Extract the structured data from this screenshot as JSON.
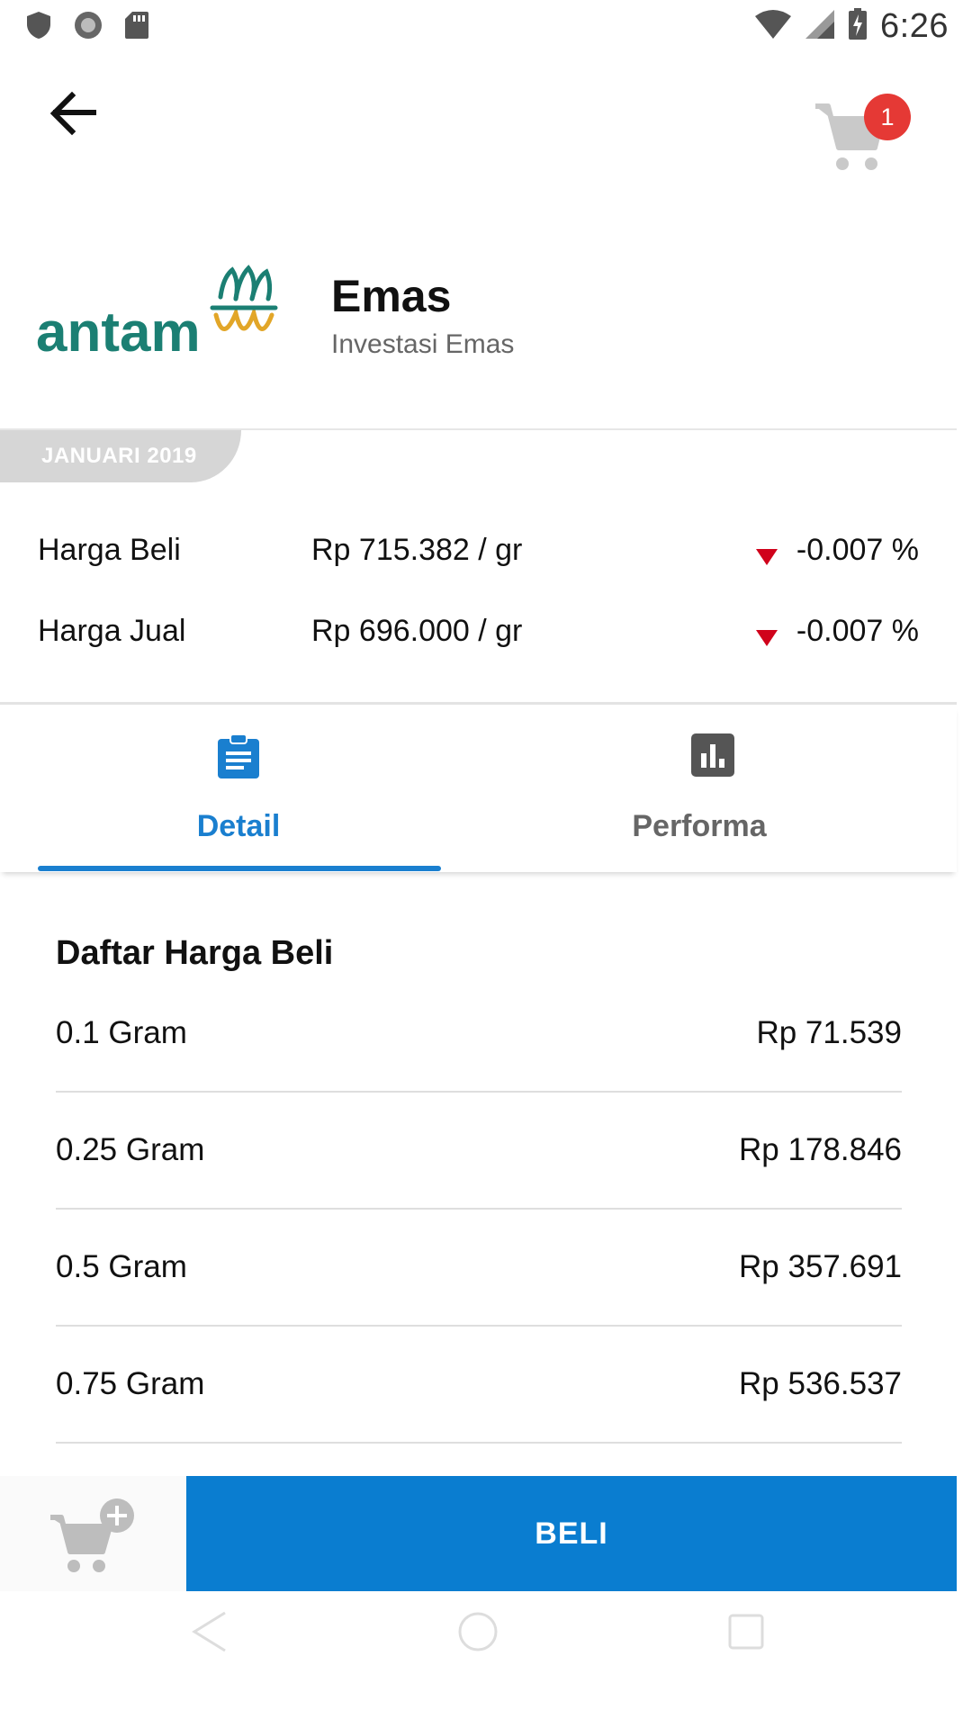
{
  "status_bar": {
    "time": "6:26"
  },
  "header": {
    "cart_count": "1"
  },
  "product": {
    "logo_text": "antam",
    "title": "Emas",
    "subtitle": "Investasi Emas"
  },
  "prices": {
    "period": "JANUARI 2019",
    "rows": [
      {
        "label": "Harga Beli",
        "value": "Rp 715.382 / gr",
        "change": "-0.007 %",
        "trend": "down"
      },
      {
        "label": "Harga Jual",
        "value": "Rp 696.000 / gr",
        "change": "-0.007 %",
        "trend": "down"
      }
    ]
  },
  "tabs": [
    {
      "label": "Detail",
      "active": true
    },
    {
      "label": "Performa",
      "active": false
    }
  ],
  "price_list": {
    "title": "Daftar Harga Beli",
    "items": [
      {
        "weight": "0.1 Gram",
        "price": "Rp 71.539"
      },
      {
        "weight": "0.25 Gram",
        "price": "Rp 178.846"
      },
      {
        "weight": "0.5 Gram",
        "price": "Rp 357.691"
      },
      {
        "weight": "0.75 Gram",
        "price": "Rp 536.537"
      }
    ]
  },
  "actions": {
    "buy_label": "BELI"
  },
  "colors": {
    "primary": "#0a7dd0",
    "tab_active": "#1a7fcf",
    "badge": "#e53935",
    "trend_down": "#d0021b",
    "logo_teal": "#1b7f73",
    "logo_gold": "#e2a628"
  }
}
